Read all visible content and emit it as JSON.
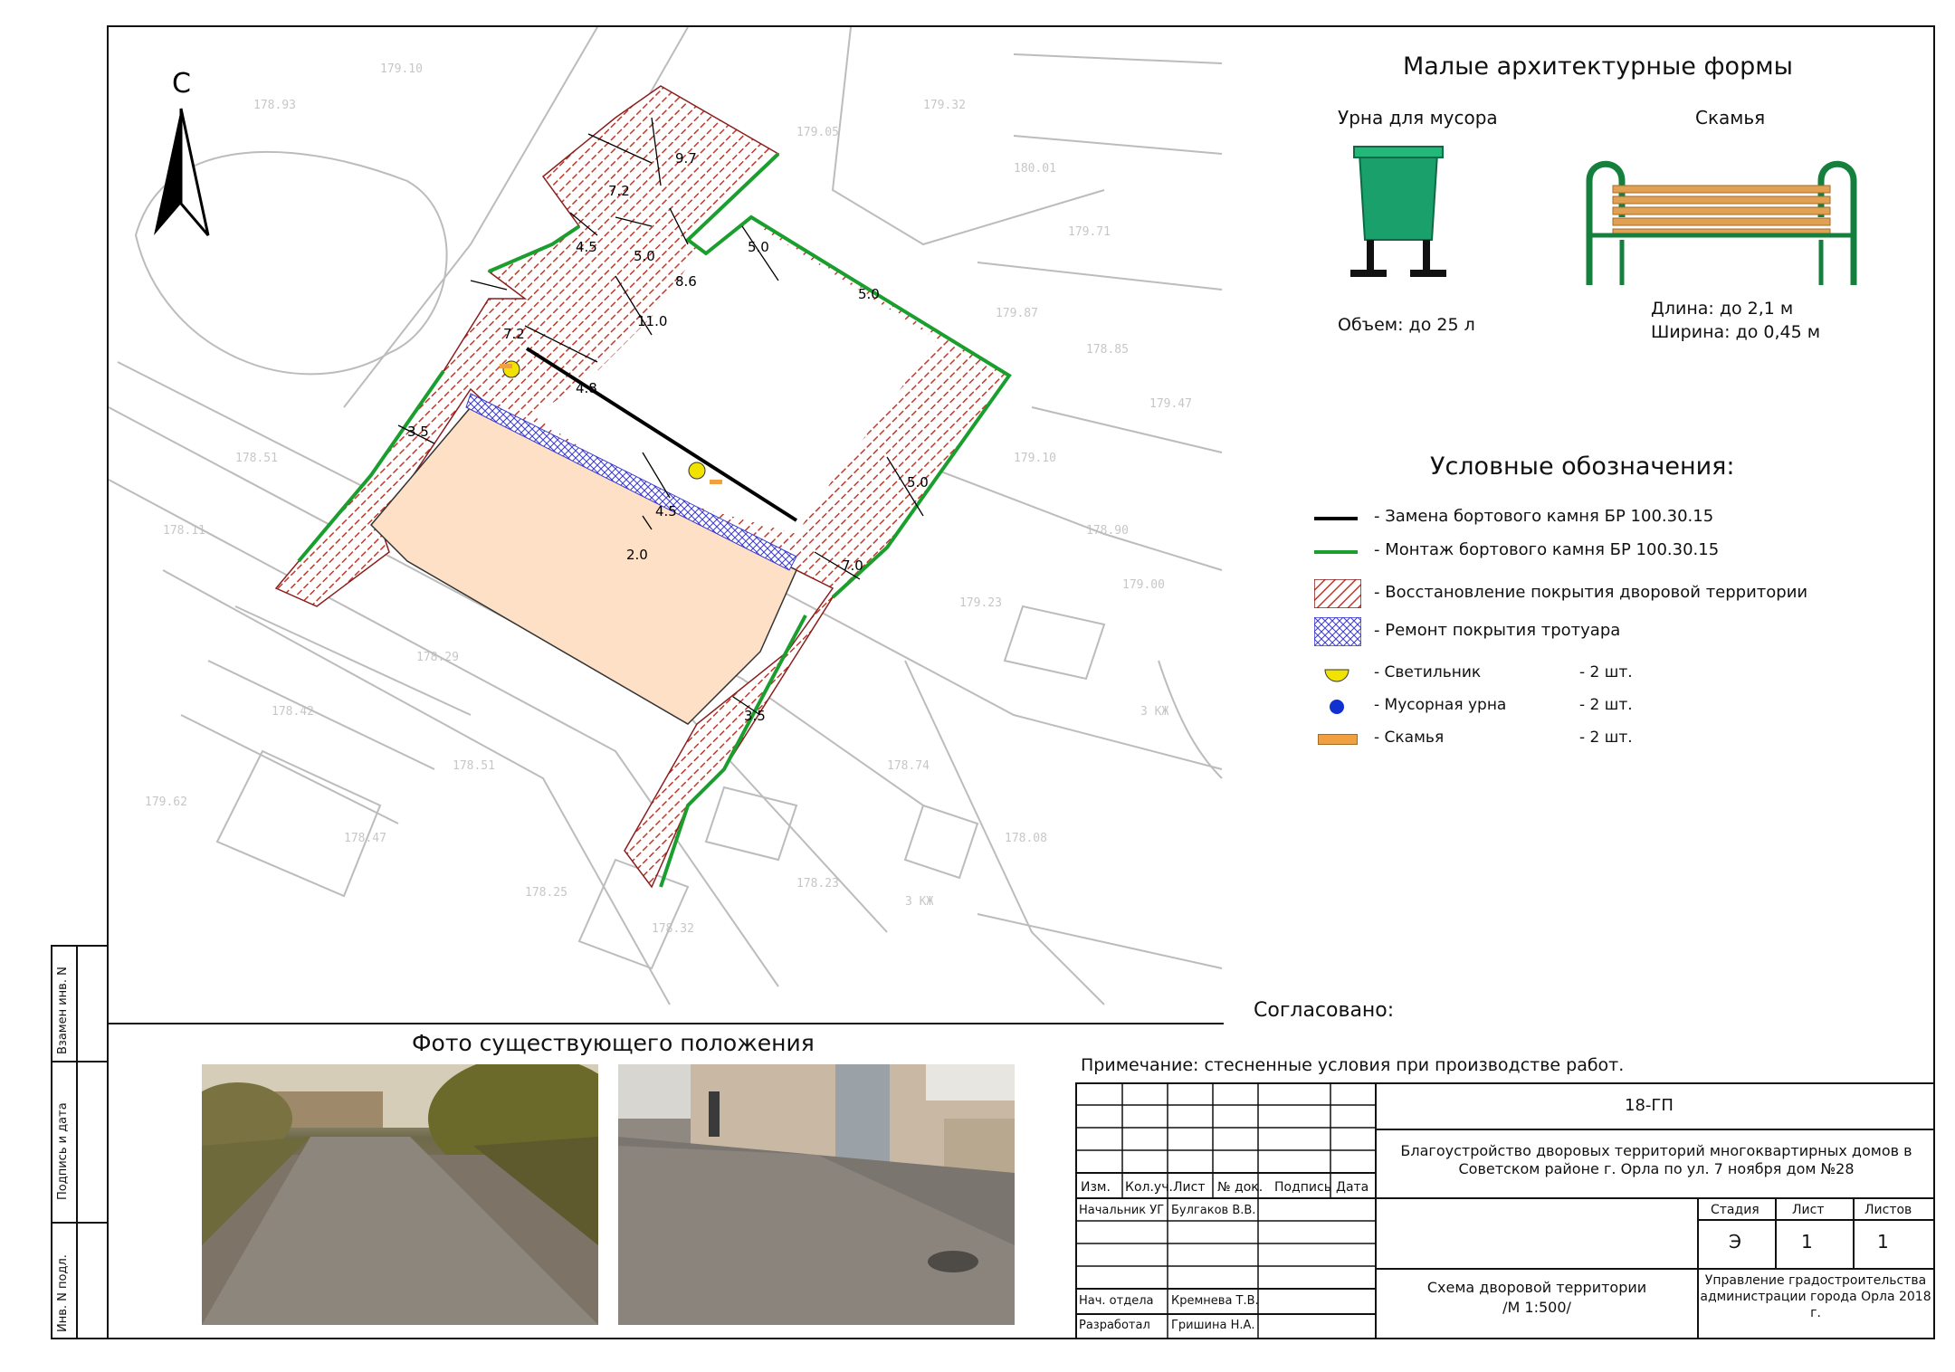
{
  "north_label": "С",
  "mafs": {
    "title": "Малые архитектурные формы",
    "urn": {
      "name": "Урна для мусора",
      "spec": "Объем: до 25 л"
    },
    "bench": {
      "name": "Скамья",
      "spec_length": "Длина: до 2,1 м",
      "spec_width": "Ширина: до 0,45 м"
    }
  },
  "legend": {
    "title": "Условные обозначения:",
    "items": [
      {
        "label": "- Замена бортового камня БР 100.30.15",
        "color": "#000000"
      },
      {
        "label": "- Монтаж бортового камня БР 100.30.15",
        "color": "#1a9e2e"
      },
      {
        "label": "- Восстановление покрытия дворовой территории",
        "color": "#c0392b"
      },
      {
        "label": "- Ремонт покрытия тротуара",
        "color": "#3a3ad0"
      },
      {
        "label": "- Светильник",
        "count": "- 2 шт.",
        "color": "#f2e200"
      },
      {
        "label": "- Мусорная урна",
        "count": "- 2 шт.",
        "color": "#1030d0"
      },
      {
        "label": "- Скамья",
        "count": "- 2 шт.",
        "color": "#f0a040"
      }
    ]
  },
  "dimensions": [
    "7.2",
    "9.7",
    "4.5",
    "5.0",
    "8.6",
    "5.0",
    "5.0",
    "11.0",
    "7.2",
    "4.8",
    "3.5",
    "4.5",
    "2.0",
    "5.0",
    "7.0",
    "3.5"
  ],
  "agreed": "Согласовано:",
  "photos_title": "Фото существующего положения",
  "note": "Примечание: стесненные условия при производстве работ.",
  "side_stamp": [
    "Взамен инв. N",
    "Подпись и дата",
    "Инв. N подл."
  ],
  "stamp": {
    "code": "18-ГП",
    "project": "Благоустройство дворовых территорий многоквартирных домов в Советском районе г. Орла по ул. 7 ноября дом №28",
    "headers": [
      "Изм.",
      "Кол.уч.",
      "Лист",
      "№ док.",
      "Подпись",
      "Дата"
    ],
    "rows": [
      {
        "role": "Начальник УГ",
        "name": "Булгаков В.В."
      },
      {
        "role": "Нач. отдела",
        "name": "Кремнева Т.В."
      },
      {
        "role": "Разработал",
        "name": "Гришина Н.А."
      }
    ],
    "stage_headers": [
      "Стадия",
      "Лист",
      "Листов"
    ],
    "stage_values": [
      "Э",
      "1",
      "1"
    ],
    "sheet_title": "Схема дворовой территории\n/М 1:500/",
    "org": "Управление градостроительства администрации города Орла 2018 г."
  }
}
